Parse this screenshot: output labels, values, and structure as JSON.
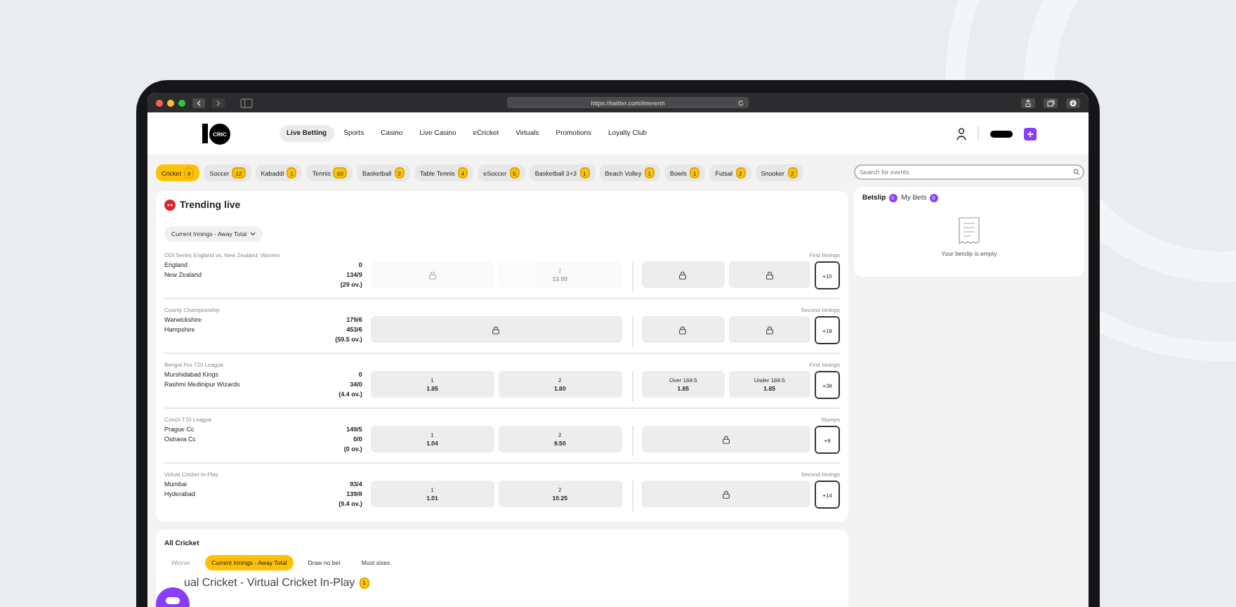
{
  "browser": {
    "url": "https://twitter.com/imerenn"
  },
  "header": {
    "logo": "CRIC",
    "nav": [
      {
        "label": "Live Betting",
        "selected": true
      },
      {
        "label": "Sports",
        "selected": false
      },
      {
        "label": "Casino",
        "selected": false
      },
      {
        "label": "Live Casino",
        "selected": false
      },
      {
        "label": "eCricket",
        "selected": false
      },
      {
        "label": "Virtuals",
        "selected": false
      },
      {
        "label": "Promotions",
        "selected": false
      },
      {
        "label": "Loyalty Club",
        "selected": false
      }
    ]
  },
  "sports": [
    {
      "label": "Cricket",
      "count": "9",
      "selected": true
    },
    {
      "label": "Soccer",
      "count": "12",
      "selected": false
    },
    {
      "label": "Kabaddi",
      "count": "1",
      "selected": false
    },
    {
      "label": "Tennis",
      "count": "60",
      "selected": false
    },
    {
      "label": "Basketball",
      "count": "2",
      "selected": false
    },
    {
      "label": "Table Tennis",
      "count": "4",
      "selected": false
    },
    {
      "label": "eSoccer",
      "count": "5",
      "selected": false
    },
    {
      "label": "Basketball 3+3",
      "count": "1",
      "selected": false
    },
    {
      "label": "Beach Volley",
      "count": "1",
      "selected": false
    },
    {
      "label": "Bowls",
      "count": "1",
      "selected": false
    },
    {
      "label": "Futsal",
      "count": "2",
      "selected": false
    },
    {
      "label": "Snooker",
      "count": "2",
      "selected": false
    }
  ],
  "search": {
    "placeholder": "Search for events"
  },
  "trending": {
    "title": "Trending live",
    "market_dropdown": "Current Innings - Away Total",
    "matches": [
      {
        "league": "ODI Series England vs. New Zealand, Women",
        "period": "First Innings",
        "teams": [
          "England",
          "New Zealand"
        ],
        "scores": [
          "0",
          "134/9",
          "(29 ov.)"
        ],
        "markets": [
          [
            {
              "kind": "locked",
              "disabled": true
            },
            {
              "kind": "odd",
              "label": "2",
              "price": "13.00",
              "disabled": true
            }
          ],
          [
            {
              "kind": "locked",
              "disabled": false
            },
            {
              "kind": "locked",
              "disabled": false
            }
          ]
        ],
        "more": "+10"
      },
      {
        "league": "County Championship",
        "period": "Second Innings",
        "teams": [
          "Warwickshire",
          "Hampshire"
        ],
        "scores": [
          "179/6",
          "453/6",
          "(59.5 ov.)"
        ],
        "markets": [
          [
            {
              "kind": "locked",
              "disabled": false
            }
          ],
          [
            {
              "kind": "locked",
              "disabled": false
            },
            {
              "kind": "locked",
              "disabled": false
            }
          ]
        ],
        "more": "+19"
      },
      {
        "league": "Bengal Pro T20 League",
        "period": "First Innings",
        "teams": [
          "Murshidabad Kings",
          "Rashmi Medinipur Wizards"
        ],
        "scores": [
          "0",
          "34/0",
          "(4.4 ov.)"
        ],
        "markets": [
          [
            {
              "kind": "odd",
              "label": "1",
              "price": "1.85",
              "disabled": false
            },
            {
              "kind": "odd",
              "label": "2",
              "price": "1.80",
              "disabled": false
            }
          ],
          [
            {
              "kind": "odd",
              "label": "Over 169.5",
              "price": "1.85",
              "disabled": false
            },
            {
              "kind": "odd",
              "label": "Under 169.5",
              "price": "1.85",
              "disabled": false
            }
          ]
        ],
        "more": "+39"
      },
      {
        "league": "Czech T10 League",
        "period": "Stumps",
        "teams": [
          "Prague Cc",
          "Ostrava Cc"
        ],
        "scores": [
          "149/5",
          "0/0",
          "(0 ov.)"
        ],
        "markets": [
          [
            {
              "kind": "odd",
              "label": "1",
              "price": "1.04",
              "disabled": false
            },
            {
              "kind": "odd",
              "label": "2",
              "price": "9.50",
              "disabled": false
            }
          ],
          [
            {
              "kind": "locked",
              "disabled": false
            }
          ]
        ],
        "more": "+9"
      },
      {
        "league": "Virtual Cricket In-Play",
        "period": "Second Innings",
        "teams": [
          "Mumbai",
          "Hyderabad"
        ],
        "scores": [
          "93/4",
          "139/8",
          "(9.4 ov.)"
        ],
        "markets": [
          [
            {
              "kind": "odd",
              "label": "1",
              "price": "1.01",
              "disabled": false
            },
            {
              "kind": "odd",
              "label": "2",
              "price": "10.25",
              "disabled": false
            }
          ],
          [
            {
              "kind": "locked",
              "disabled": false
            }
          ]
        ],
        "more": "+14"
      }
    ]
  },
  "betslip": {
    "tabs": [
      {
        "label": "Betslip",
        "count": "0",
        "selected": true
      },
      {
        "label": "My Bets",
        "count": "0",
        "selected": false
      }
    ],
    "empty_text": "Your betslip is empty"
  },
  "all_cricket": {
    "title": "All Cricket",
    "tabs": [
      {
        "label": "Winner",
        "selected": false
      },
      {
        "label": "Current Innings - Away Total",
        "selected": true
      },
      {
        "label": "Draw no bet",
        "selected": false
      },
      {
        "label": "Most sixes",
        "selected": false
      }
    ],
    "competition": {
      "title": "ual Cricket - Virtual Cricket In-Play",
      "count": "1"
    }
  }
}
